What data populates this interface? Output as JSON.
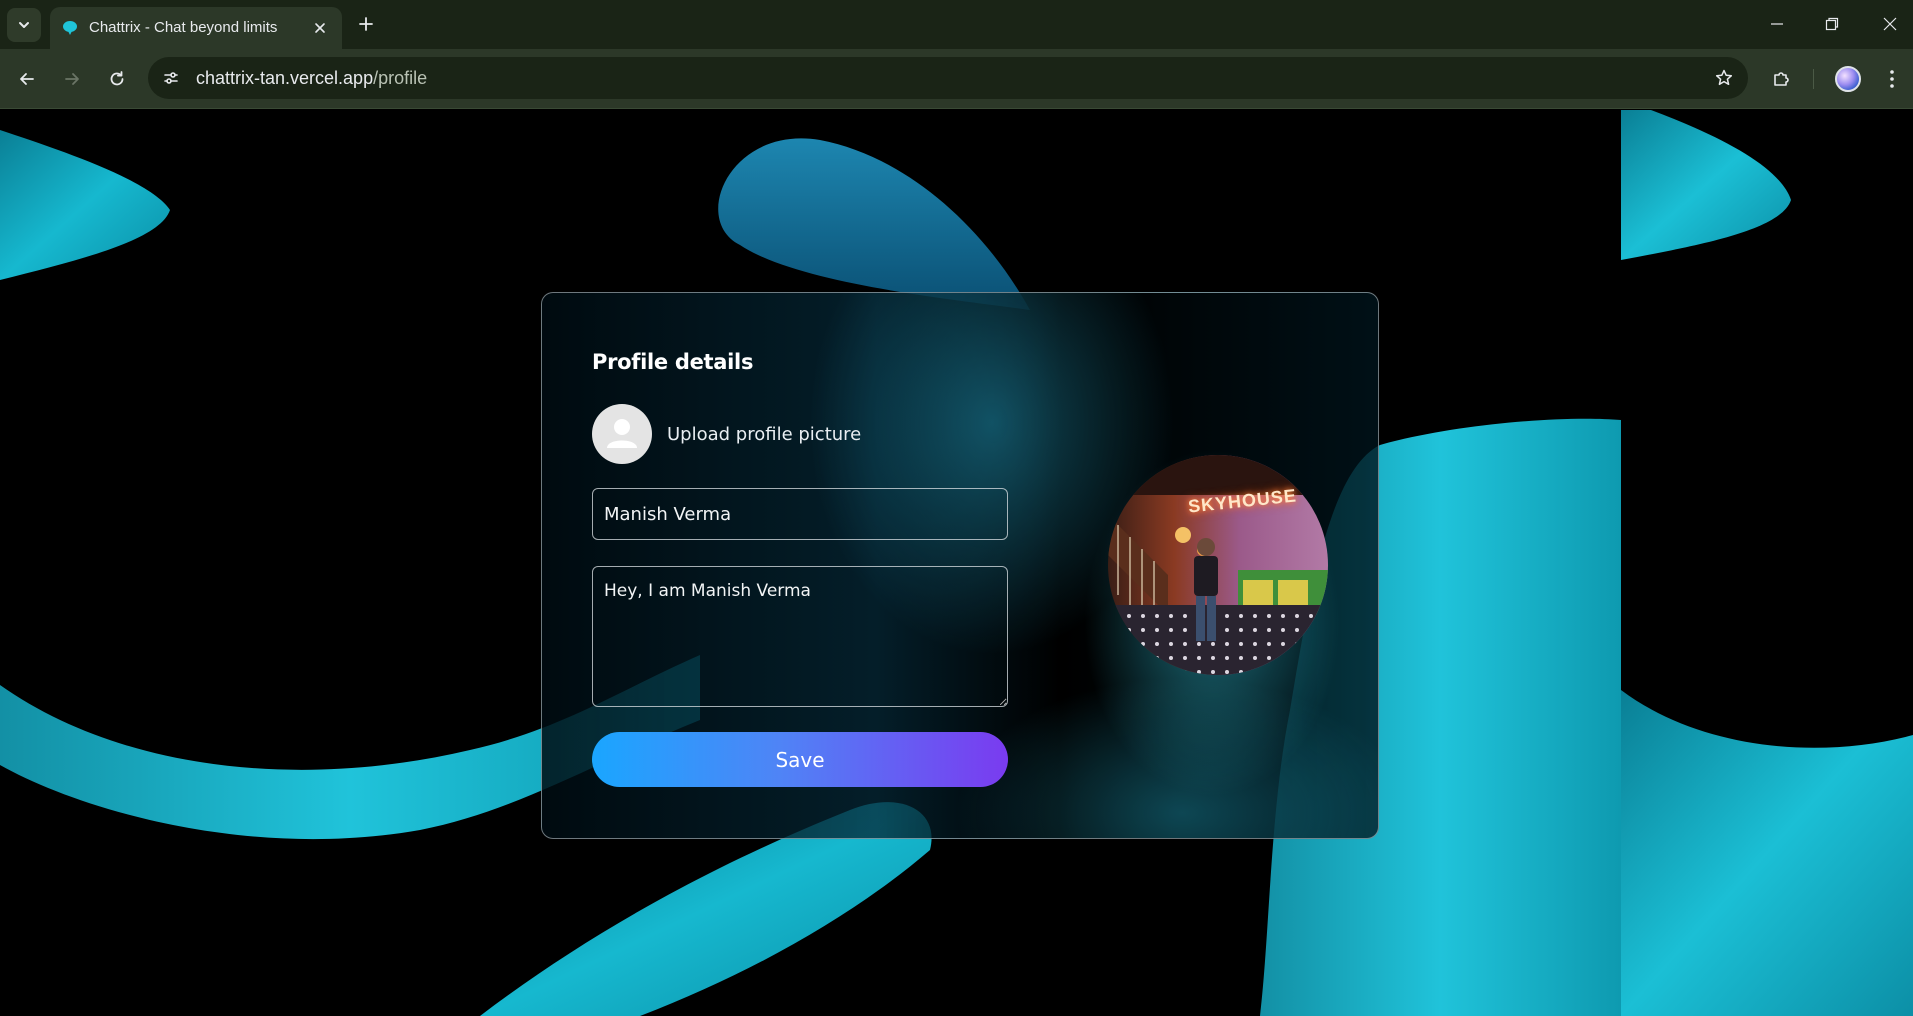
{
  "browser": {
    "tab_title": "Chattrix - Chat beyond limits",
    "url_host": "chattrix-tan.vercel.app",
    "url_path": "/profile"
  },
  "icons": {
    "tab_list": "chevron-down-icon",
    "favicon": "chat-bubble-icon",
    "tab_close": "close-icon",
    "new_tab": "plus-icon",
    "minimize": "minimize-icon",
    "restore": "restore-icon",
    "close_window": "close-icon",
    "back": "arrow-left-icon",
    "forward": "arrow-right-icon",
    "reload": "reload-icon",
    "site_info": "tune-icon",
    "bookmark": "star-icon",
    "extensions": "puzzle-icon",
    "profile": "avatar-icon",
    "menu": "kebab-menu-icon",
    "upload_placeholder": "user-icon"
  },
  "profile": {
    "title": "Profile details",
    "upload_label": "Upload profile picture",
    "name_value": "Manish Verma",
    "bio_value": "Hey, I am Manish Verma",
    "save_label": "Save",
    "photo_sign_text": "SKYHOUSE"
  },
  "colors": {
    "chrome_bg": "#1a2416",
    "toolbar_bg": "#2c3828",
    "accent_cyan": "#1fc4d9",
    "save_gradient_start": "#1aa6ff",
    "save_gradient_end": "#7a3bf0"
  }
}
